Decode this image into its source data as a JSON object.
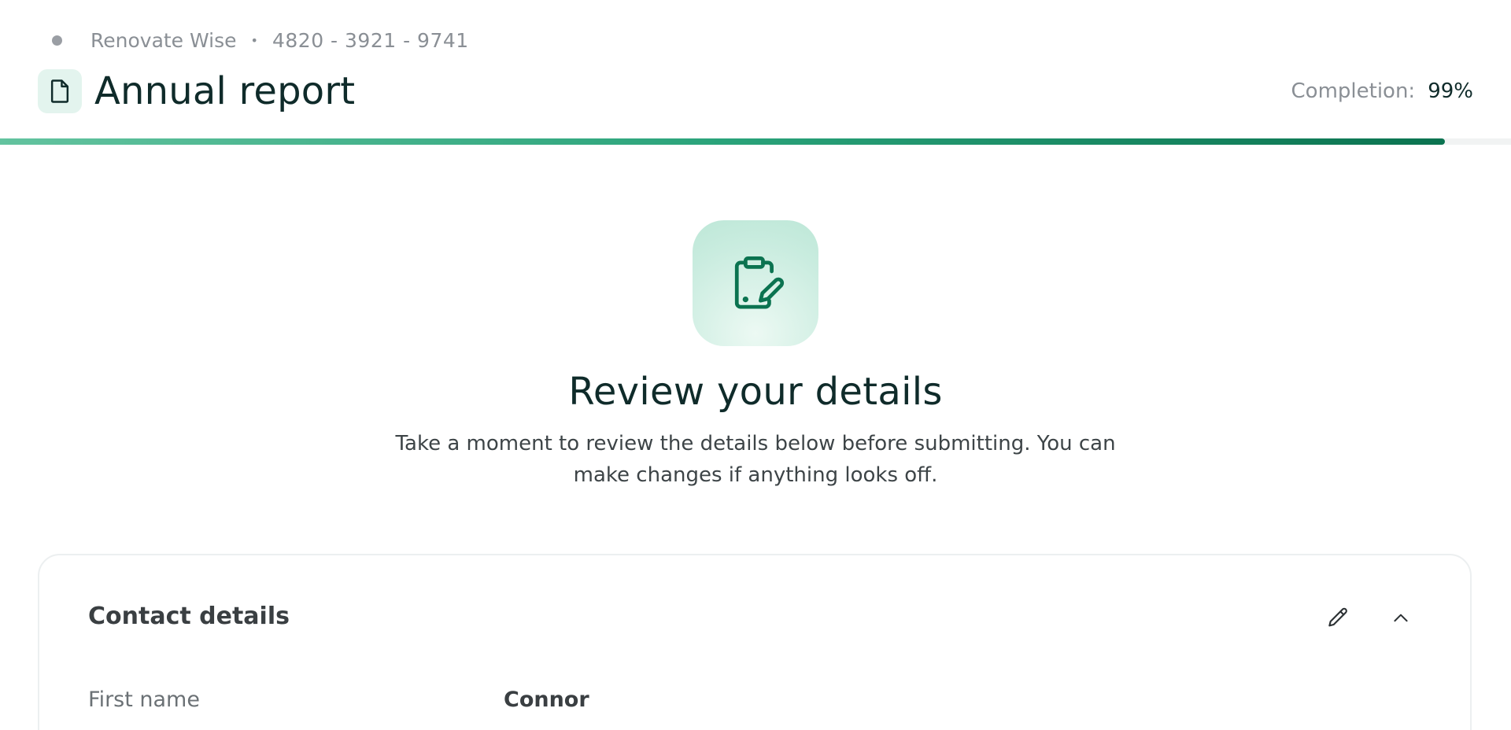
{
  "header": {
    "company": "Renovate Wise",
    "separator": "•",
    "account_number": "4820 - 3921 - 9741",
    "title": "Annual report",
    "completion_label": "Completion:",
    "completion_value": "99%",
    "progress_fraction": 0.99,
    "icons": {
      "status": "status-dot-icon",
      "document": "document-icon"
    }
  },
  "hero": {
    "icon": "clipboard-edit-icon",
    "title": "Review your details",
    "subtitle": "Take a moment to review the details below before submitting. You can make changes if anything looks off."
  },
  "section": {
    "title": "Contact details",
    "edit_icon": "pencil-icon",
    "collapse_icon": "chevron-up-icon",
    "fields": [
      {
        "label": "First name",
        "value": "Connor"
      }
    ]
  },
  "colors": {
    "accent": "#0b7350",
    "accent_light": "#63c39f",
    "hero_bg": "#c9ecdf",
    "title_text": "#0f2b2a",
    "muted_text": "#8a8f95"
  }
}
